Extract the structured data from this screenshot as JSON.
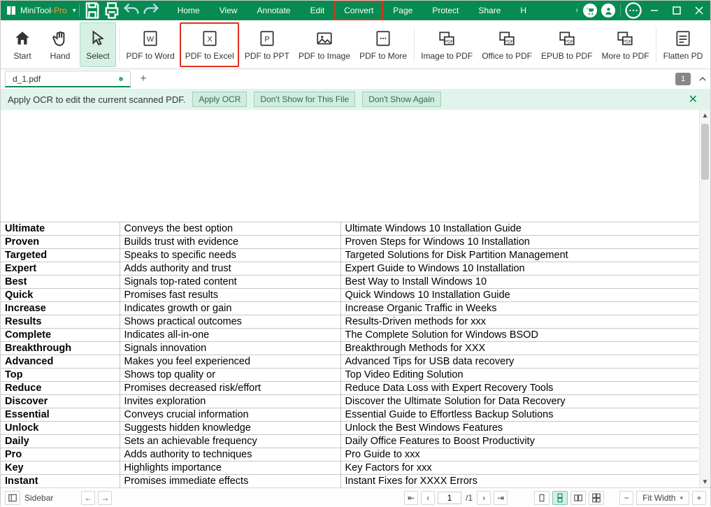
{
  "app": {
    "name1": "MiniTool",
    "name2": "-Pro"
  },
  "menus": [
    "Home",
    "View",
    "Annotate",
    "Edit",
    "Convert",
    "Page",
    "Protect",
    "Share",
    "H"
  ],
  "menu_highlight_index": 4,
  "tools": [
    {
      "label": "Start",
      "icon": "home"
    },
    {
      "label": "Hand",
      "icon": "hand"
    },
    {
      "label": "Select",
      "icon": "arrow",
      "active": true
    },
    {
      "sep": true
    },
    {
      "label": "PDF to Word",
      "icon": "word"
    },
    {
      "label": "PDF to Excel",
      "icon": "excel",
      "highlight": true
    },
    {
      "label": "PDF to PPT",
      "icon": "ppt"
    },
    {
      "label": "PDF to Image",
      "icon": "image"
    },
    {
      "label": "PDF to More",
      "icon": "more"
    },
    {
      "sep": true
    },
    {
      "label": "Image to PDF",
      "icon": "img2pdf"
    },
    {
      "label": "Office to PDF",
      "icon": "off2pdf"
    },
    {
      "label": "EPUB to PDF",
      "icon": "epub2pdf"
    },
    {
      "label": "More to PDF",
      "icon": "more2pdf"
    },
    {
      "sep": true
    },
    {
      "label": "Flatten PD",
      "icon": "flatten"
    }
  ],
  "tab": {
    "name": "d_1.pdf",
    "page_badge": "1"
  },
  "ocr": {
    "msg": "Apply OCR to edit the current scanned PDF.",
    "b1": "Apply OCR",
    "b2": "Don't Show for This File",
    "b3": "Don't Show Again"
  },
  "table": [
    [
      "Ultimate",
      "Conveys the best option",
      "Ultimate Windows 10 Installation Guide"
    ],
    [
      "Proven",
      "Builds trust with evidence",
      "Proven Steps for Windows 10 Installation"
    ],
    [
      "Targeted",
      "Speaks to specific needs",
      "Targeted Solutions for Disk Partition Management"
    ],
    [
      "Expert",
      "Adds authority and trust",
      "Expert Guide to Windows 10 Installation"
    ],
    [
      "Best",
      "Signals top-rated content",
      "Best Way to Install Windows 10"
    ],
    [
      "Quick",
      "Promises fast results",
      "Quick Windows 10 Installation Guide"
    ],
    [
      "Increase",
      "Indicates growth or gain",
      "Increase Organic Traffic in Weeks"
    ],
    [
      "Results",
      "Shows practical outcomes",
      "Results-Driven methods for xxx"
    ],
    [
      "Complete",
      "Indicates all-in-one",
      "The Complete Solution for Windows BSOD"
    ],
    [
      "Breakthrough",
      "Signals innovation",
      "Breakthrough Methods for XXX"
    ],
    [
      "Advanced",
      "Makes you feel experienced",
      "Advanced Tips for USB data recovery"
    ],
    [
      "Top",
      "Shows top quality or",
      "Top Video Editing Solution"
    ],
    [
      "Reduce",
      "Promises decreased risk/effort",
      "Reduce Data Loss with Expert Recovery Tools"
    ],
    [
      "Discover",
      "Invites exploration",
      "Discover the Ultimate Solution for Data Recovery"
    ],
    [
      "Essential",
      "Conveys crucial information",
      "Essential Guide to Effortless Backup Solutions"
    ],
    [
      "Unlock",
      "Suggests hidden knowledge",
      "Unlock the Best Windows Features"
    ],
    [
      "Daily",
      "Sets an achievable frequency",
      "Daily Office Features to Boost Productivity"
    ],
    [
      "Pro",
      "Adds authority to techniques",
      "Pro Guide to xxx"
    ],
    [
      "Key",
      "Highlights importance",
      "Key Factors for xxx"
    ],
    [
      "Instant",
      "Promises immediate effects",
      "Instant Fixes for XXXX Errors"
    ]
  ],
  "status": {
    "sidebar": "Sidebar",
    "page_current": "1",
    "page_total": "/1",
    "zoom": "Fit Width"
  }
}
